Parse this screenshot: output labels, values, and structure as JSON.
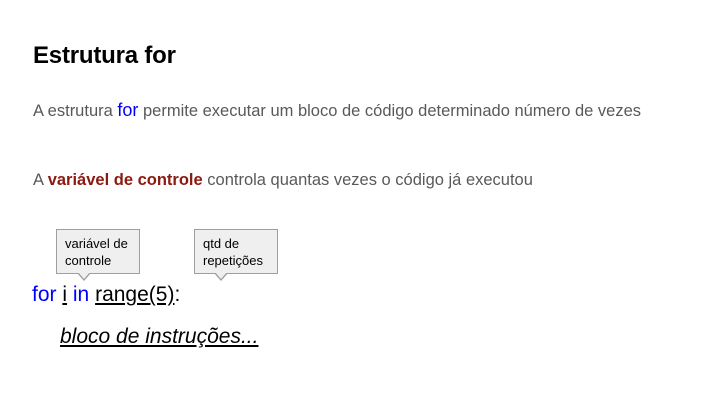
{
  "slide": {
    "title": "Estrutura for",
    "paragraph1": {
      "before": "A estrutura ",
      "keyword": "for",
      "after": " permite executar um bloco de código determinado número de vezes"
    },
    "paragraph2": {
      "before": "A ",
      "keyword": "variável de controle",
      "after": " controla quantas vezes o código já executou"
    },
    "callouts": {
      "control_variable": {
        "line1": "variável de",
        "line2": "controle"
      },
      "repetitions": {
        "line1": "qtd de",
        "line2": "repetições"
      }
    },
    "code": {
      "kw_for": "for",
      "var": "i",
      "kw_in": "in",
      "call": "range(5)",
      "colon": ":",
      "block": "bloco de instruções..."
    }
  },
  "colors": {
    "keyword_blue": "#0000ff",
    "highlight_red": "#8b1a10",
    "body_text": "#595959",
    "callout_fill": "#efefef"
  }
}
